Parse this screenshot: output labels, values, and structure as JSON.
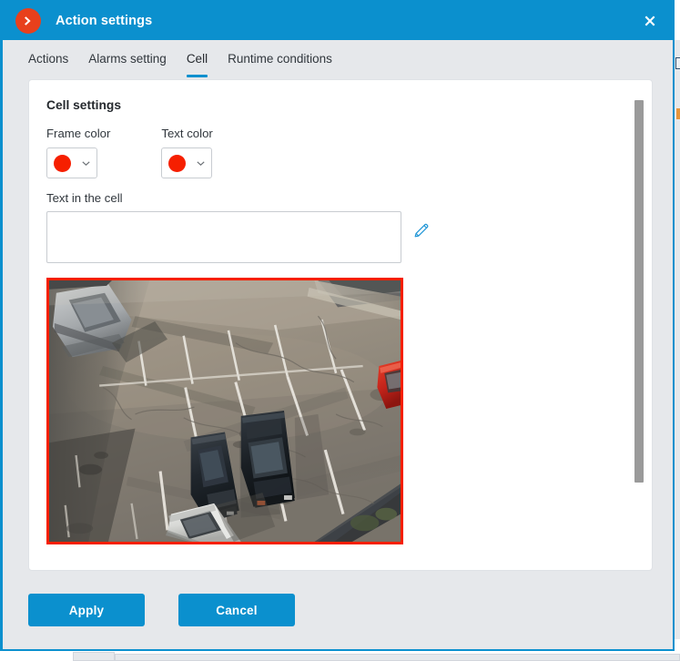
{
  "window": {
    "title": "Action settings",
    "app_icon": "circle-arrow-right-icon",
    "close_icon": "close-icon",
    "accent_color": "#0B90CE",
    "badge_color": "#E8401C",
    "body_color": "#E6E8EB"
  },
  "tabs": [
    {
      "label": "Actions",
      "active": false
    },
    {
      "label": "Alarms setting",
      "active": false
    },
    {
      "label": "Cell",
      "active": true
    },
    {
      "label": "Runtime conditions",
      "active": false
    }
  ],
  "cell_settings": {
    "section_title": "Cell settings",
    "frame_color": {
      "label": "Frame color",
      "value": "#F61F00",
      "caret_icon": "chevron-down-icon"
    },
    "text_color": {
      "label": "Text color",
      "value": "#F61F00",
      "caret_icon": "chevron-down-icon"
    },
    "text_in_cell": {
      "label": "Text in the cell",
      "value": "",
      "placeholder": ""
    },
    "edit_icon": "pencil-icon",
    "preview": {
      "name": "camera-cell-preview",
      "frame_color": "#F61F00",
      "description": "Aerial CCTV view of an asphalt parking lot with white stall lines, a dark sedan and a dark SUV parked mid-frame, a white sedan at the bottom, a grey car top-left and a red car at the right edge."
    },
    "scrollbar": {
      "name": "card-vertical-scrollbar",
      "thumb_color": "#9A9A9A"
    }
  },
  "footer": {
    "apply_label": "Apply",
    "cancel_label": "Cancel"
  }
}
